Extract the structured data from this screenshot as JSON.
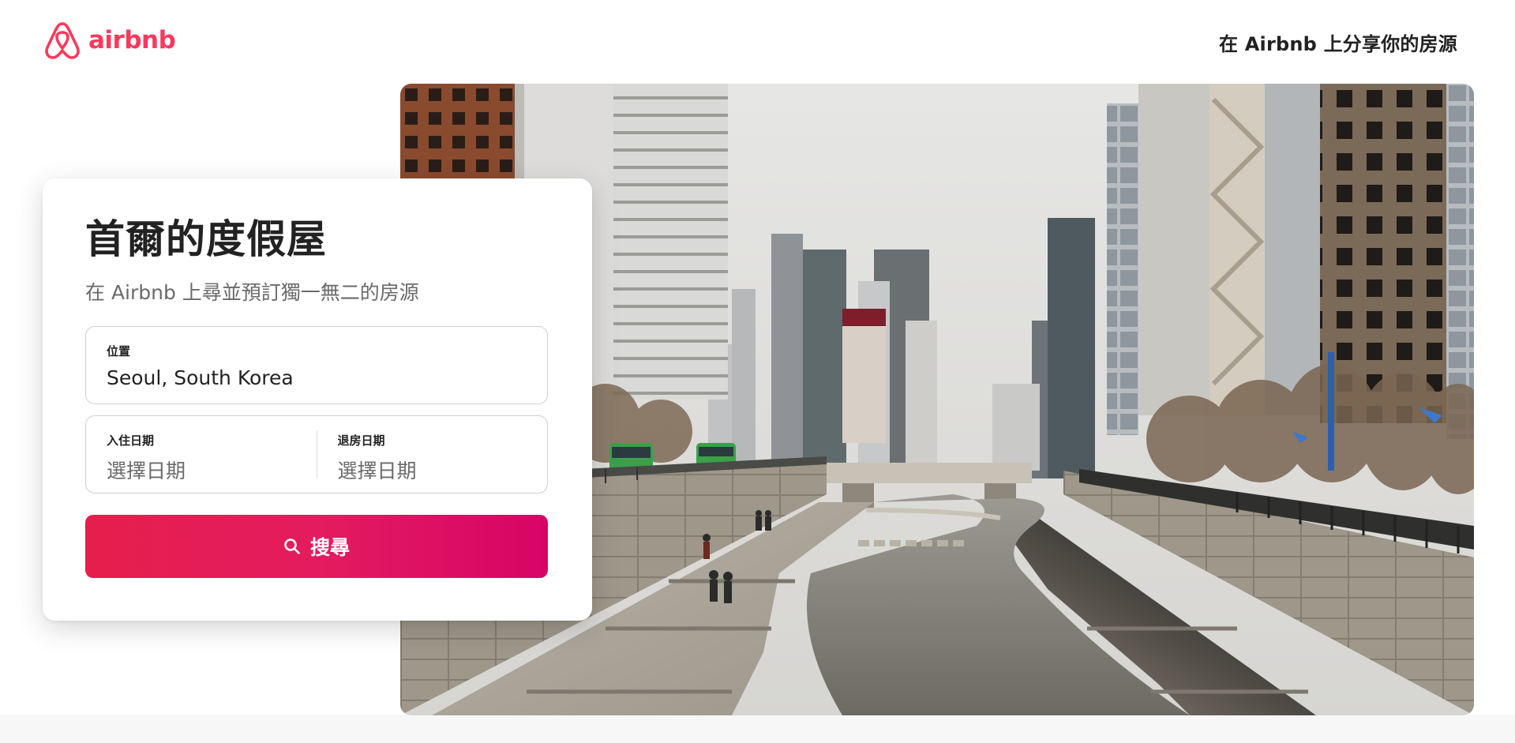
{
  "header": {
    "logo_text": "airbnb",
    "host_link": "在 Airbnb 上分享你的房源"
  },
  "search_card": {
    "title": "首爾的度假屋",
    "subtitle": "在 Airbnb 上尋並預訂獨一無二的房源",
    "location": {
      "label": "位置",
      "value": "Seoul, South Korea"
    },
    "checkin": {
      "label": "入住日期",
      "placeholder": "選擇日期"
    },
    "checkout": {
      "label": "退房日期",
      "placeholder": "選擇日期"
    },
    "search_button": "搜尋"
  },
  "hero": {
    "alt": "Seoul Cheonggyecheon stream"
  },
  "colors": {
    "brand": "#ff385c",
    "button_start": "#e61e4d",
    "button_end": "#d70466"
  }
}
